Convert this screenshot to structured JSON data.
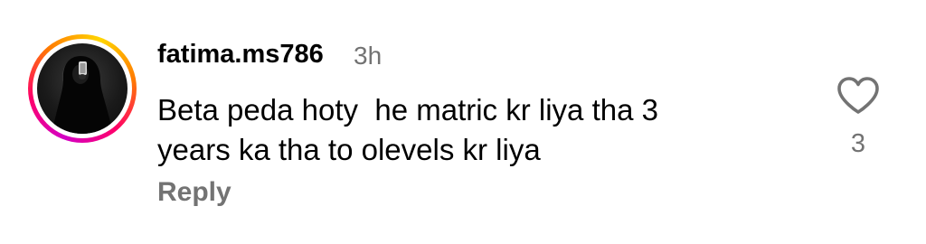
{
  "comment": {
    "username": "fatima.ms786",
    "timestamp": "3h",
    "text": "Beta peda hoty  he matric kr liya tha 3\nyears ka tha to olevels kr liya",
    "reply_label": "Reply",
    "like_count": "3",
    "like_icon": "heart-outline-icon",
    "avatar_ring_colors": [
      "#d300c5",
      "#ff0069",
      "#ff7a00",
      "#ffd600"
    ]
  }
}
